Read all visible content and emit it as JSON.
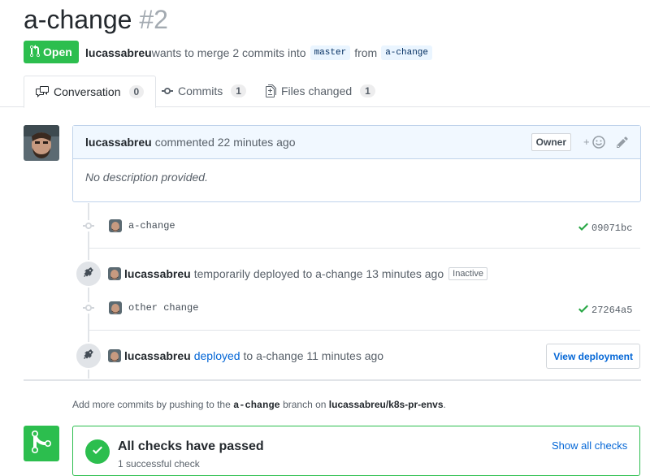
{
  "pr": {
    "title": "a-change",
    "number": "#2",
    "state": "Open",
    "author": "lucassabreu",
    "merge_text": "wants to merge 2 commits into",
    "base_branch": "master",
    "from_text": "from",
    "head_branch": "a-change"
  },
  "tabs": [
    {
      "label": "Conversation",
      "count": "0",
      "icon": "comment-discussion-icon"
    },
    {
      "label": "Commits",
      "count": "1",
      "icon": "git-commit-icon"
    },
    {
      "label": "Files changed",
      "count": "1",
      "icon": "file-diff-icon"
    }
  ],
  "comment": {
    "author": "lucassabreu",
    "action": "commented 22 minutes ago",
    "role": "Owner",
    "body": "No description provided."
  },
  "timeline": {
    "commit1": {
      "message": "a-change",
      "sha": "09071bc"
    },
    "deploy1": {
      "author": "lucassabreu",
      "text": "temporarily deployed to a-change 13 minutes ago",
      "label": "Inactive"
    },
    "commit2": {
      "message": "other change",
      "sha": "27264a5"
    },
    "deploy2": {
      "author": "lucassabreu",
      "link": "deployed",
      "text": "to a-change 11 minutes ago",
      "button": "View deployment"
    }
  },
  "footer": {
    "prefix": "Add more commits by pushing to the",
    "branch": "a-change",
    "middle": "branch on",
    "repo": "lucassabreu/k8s-pr-envs",
    "suffix": "."
  },
  "merge": {
    "title": "All checks have passed",
    "subtitle": "1 successful check",
    "show_checks": "Show all checks"
  },
  "colors": {
    "green": "#2cbe4e",
    "link": "#0366d6",
    "border": "#e1e4e8"
  }
}
